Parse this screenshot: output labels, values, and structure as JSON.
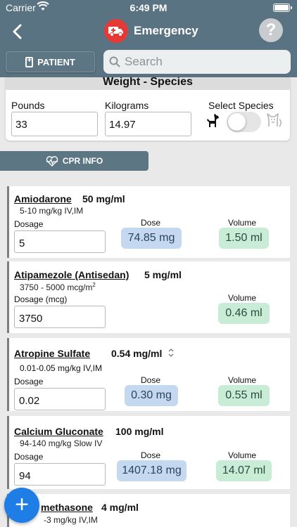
{
  "status_bar": {
    "carrier": "Carrier",
    "time": "6:49 PM"
  },
  "nav": {
    "title": "Emergency",
    "help_label": "?"
  },
  "toolbar": {
    "patient_label": "PATIENT",
    "search_placeholder": "Search"
  },
  "weight": {
    "heading": "Weight - Species",
    "pounds_label": "Pounds",
    "pounds_value": "33",
    "kilograms_label": "Kilograms",
    "kilograms_value": "14.97",
    "species_label": "Select Species",
    "species_selected": "dog"
  },
  "cpr_label": "CPR INFO",
  "drugs": [
    {
      "name": "Amiodarone",
      "concentration": "50 mg/ml",
      "range": "5-10 mg/kg IV,IM",
      "dosage_label": "Dosage",
      "dosage_value": "5",
      "dose_label": "Dose",
      "dose_value": "74.85 mg",
      "volume_label": "Volume",
      "volume_value": "1.50 ml"
    },
    {
      "name": "Atipamezole (Antisedan)",
      "concentration": "5 mg/ml",
      "range": "3750 - 5000 mcg/m",
      "range_sup": "2",
      "dosage_label": "Dosage (mcg)",
      "dosage_value": "3750",
      "volume_label": "Volume",
      "volume_value": "0.46 ml"
    },
    {
      "name": "Atropine Sulfate",
      "concentration": "0.54 mg/ml",
      "range": "0.01-0.05 mg/kg IV,IM",
      "dosage_label": "Dosage",
      "dosage_value": "0.02",
      "dose_label": "Dose",
      "dose_value": "0.30 mg",
      "volume_label": "Volume",
      "volume_value": "0.55 ml"
    },
    {
      "name": "Calcium Gluconate",
      "concentration": "100 mg/ml",
      "range": "94-140 mg/kg Slow IV",
      "dosage_label": "Dosage",
      "dosage_value": "94",
      "dose_label": "Dose",
      "dose_value": "1407.18 mg",
      "volume_label": "Volume",
      "volume_value": "14.07 ml"
    },
    {
      "name": "methasone",
      "concentration": "4 mg/ml",
      "range": "-3 mg/kg IV,IM"
    }
  ],
  "fab_label": "+"
}
